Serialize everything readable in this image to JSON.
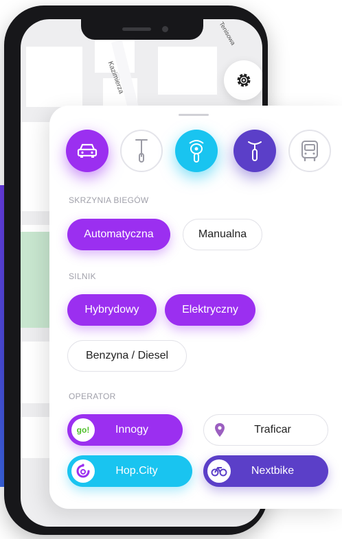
{
  "map": {
    "streets": [
      "Kazimierza",
      "Tenisowa"
    ]
  },
  "filters": {
    "vehicles": [
      {
        "name": "car",
        "icon": "car-icon",
        "selected": true,
        "color": "#9b2ff0"
      },
      {
        "name": "scooter",
        "icon": "kick-scooter-icon",
        "selected": false,
        "color": "#ffffff"
      },
      {
        "name": "moped",
        "icon": "moped-icon",
        "selected": true,
        "color": "#19c4f0"
      },
      {
        "name": "bike",
        "icon": "bicycle-icon",
        "selected": true,
        "color": "#5b3fc8"
      },
      {
        "name": "bus",
        "icon": "bus-icon",
        "selected": false,
        "color": "#ffffff"
      }
    ],
    "gearbox": {
      "title": "SKRZYNIA BIEGÓW",
      "options": [
        {
          "label": "Automatyczna",
          "selected": true
        },
        {
          "label": "Manualna",
          "selected": false
        }
      ]
    },
    "engine": {
      "title": "SILNIK",
      "options": [
        {
          "label": "Hybrydowy",
          "selected": true
        },
        {
          "label": "Elektryczny",
          "selected": true
        },
        {
          "label": "Benzyna / Diesel",
          "selected": false
        }
      ]
    },
    "operator": {
      "title": "OPERATOR",
      "options": [
        {
          "label": "Innogy",
          "logo_text": "go!",
          "selected": true,
          "color": "#9b2ff0"
        },
        {
          "label": "Traficar",
          "selected": false,
          "color": "#9b5fc0"
        },
        {
          "label": "Hop.City",
          "selected": true,
          "color": "#19c4f0"
        },
        {
          "label": "Nextbike",
          "selected": true,
          "color": "#5b3fc8"
        }
      ]
    }
  },
  "colors": {
    "accent_purple": "#9b2ff0",
    "accent_cyan": "#19c4f0",
    "accent_indigo": "#5b3fc8"
  }
}
